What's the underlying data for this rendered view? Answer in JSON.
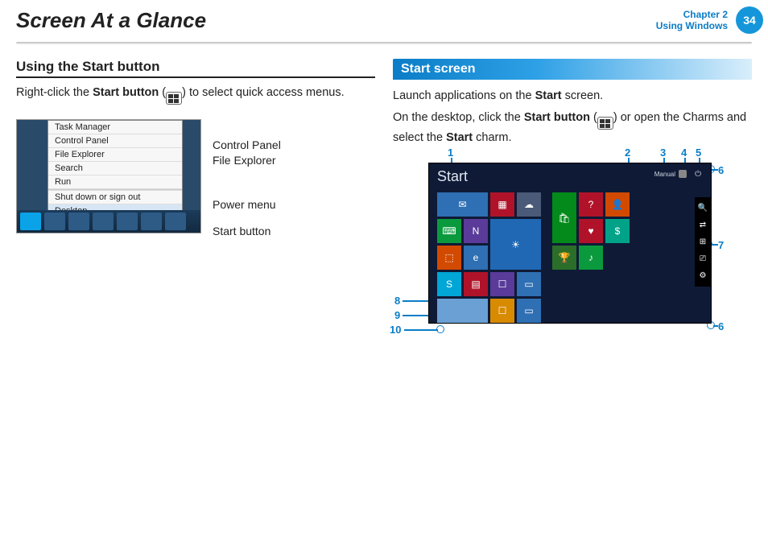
{
  "header": {
    "title": "Screen At a Glance",
    "chapter_line1": "Chapter 2",
    "chapter_line2": "Using Windows",
    "page_number": "34"
  },
  "left": {
    "heading": "Using the Start button",
    "para_pre": "Right-click the ",
    "para_bold": "Start button",
    "para_post": " to select quick access menus.",
    "menu_items": {
      "i0": "Task Manager",
      "i1": "Control Panel",
      "i2": "File Explorer",
      "i3": "Search",
      "i4": "Run",
      "i5": "Shut down or sign out",
      "i6": "Desktop"
    },
    "callouts": {
      "c0": "Control Panel",
      "c1": "File Explorer",
      "c2": "Power menu",
      "c3": "Start button"
    }
  },
  "right": {
    "heading": "Start screen",
    "p1_pre": "Launch applications on the ",
    "p1_bold": "Start",
    "p1_post": " screen.",
    "p2_pre": "On the desktop, click the ",
    "p2_bold1": "Start button",
    "p2_mid": " or open the Charms and select the ",
    "p2_bold2": "Start",
    "p2_post": " charm.",
    "start_label": "Start",
    "user_label": "Manual",
    "callout_numbers": {
      "n1": "1",
      "n2": "2",
      "n3": "3",
      "n4": "4",
      "n5": "5",
      "n6": "6",
      "n7": "7",
      "n8": "8",
      "n9": "9",
      "n10": "10"
    }
  }
}
